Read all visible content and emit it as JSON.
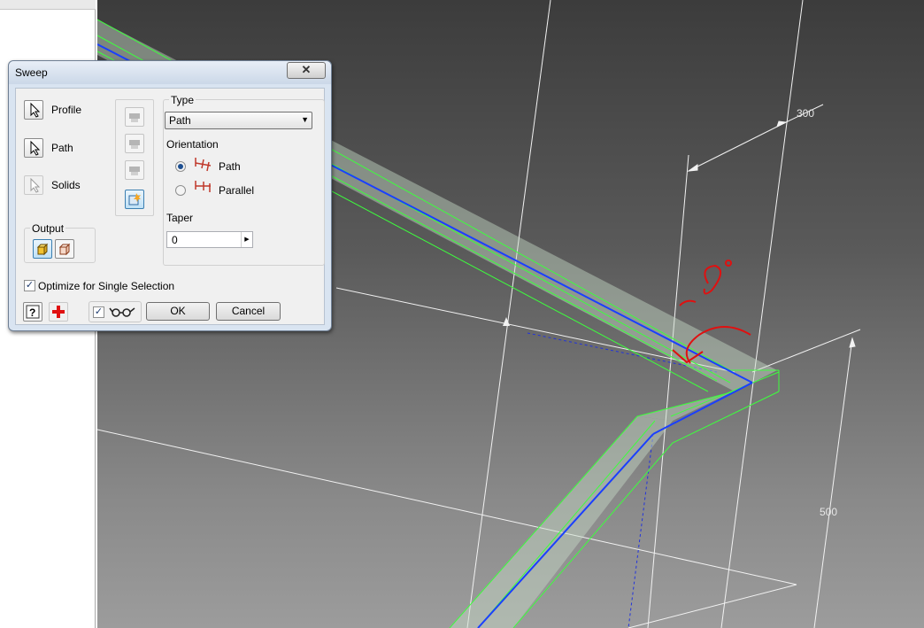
{
  "dialog": {
    "title": "Sweep",
    "close_glyph": "✕",
    "selectors": [
      {
        "label": "Profile"
      },
      {
        "label": "Path"
      },
      {
        "label": "Solids"
      }
    ],
    "output": {
      "label": "Output"
    },
    "type": {
      "label": "Type",
      "value": "Path"
    },
    "orientation": {
      "label": "Orientation",
      "options": [
        {
          "label": "Path",
          "selected": true
        },
        {
          "label": "Parallel",
          "selected": false
        }
      ]
    },
    "taper": {
      "label": "Taper",
      "value": "0"
    },
    "optimize": {
      "label": "Optimize for Single Selection",
      "checked": true
    },
    "buttons": {
      "ok": "OK",
      "cancel": "Cancel"
    }
  },
  "viewport": {
    "dimensions": [
      "300",
      "500"
    ],
    "annotation": "~8°",
    "colors": {
      "sweep_edge": "#3dff3d",
      "path_line": "#1a3fff",
      "sketch_line": "#f2f2f2",
      "annotation": "#e01010"
    }
  }
}
